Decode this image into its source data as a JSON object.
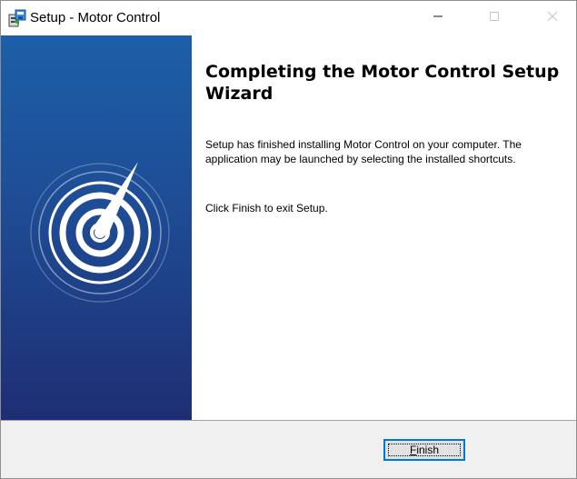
{
  "window": {
    "title": "Setup - Motor Control",
    "controls": [
      "minimize-icon",
      "maximize-icon",
      "close-icon"
    ]
  },
  "banner": {
    "logo": "speedometer-logo-icon",
    "gradient": [
      "#1c5fa8",
      "#1f2e73"
    ]
  },
  "content": {
    "heading": "Completing the Motor Control Setup Wizard",
    "paragraph1": "Setup has finished installing Motor Control on your computer. The application may be launched by selecting the installed shortcuts.",
    "paragraph2": "Click Finish to exit Setup."
  },
  "footer": {
    "finish_accel": "F",
    "finish_rest": "inish"
  },
  "colors": {
    "focus_border": "#0078d7",
    "footer_bg": "#f0f0f0"
  }
}
